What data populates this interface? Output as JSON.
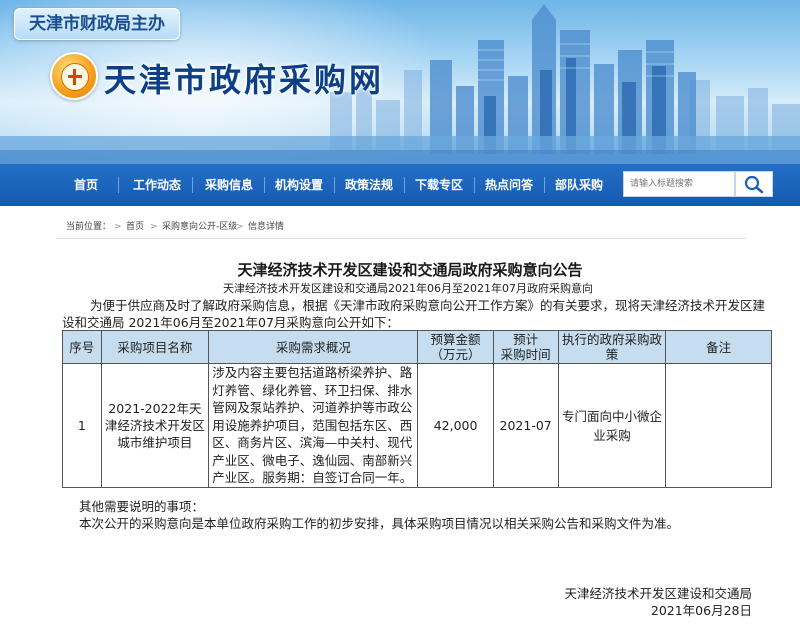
{
  "header": {
    "sponsor": "天津市财政局主办",
    "site_title": "天津市政府采购网",
    "logo_icon": "procurement-logo-icon"
  },
  "nav": {
    "items": [
      "首页",
      "工作动态",
      "采购信息",
      "机构设置",
      "政策法规",
      "下载专区",
      "热点问答",
      "部队采购"
    ],
    "search_placeholder": "请输入标题搜索",
    "search_icon": "search-icon"
  },
  "breadcrumb": {
    "label": "当前位置：",
    "items": [
      "首页",
      "采购意向公开-区级",
      "信息详情"
    ],
    "separator": ">"
  },
  "article": {
    "title": "天津经济技术开发区建设和交通局政府采购意向公告",
    "subtitle": "天津经济技术开发区建设和交通局2021年06月至2021年07月政府采购意向",
    "intro_line1": "为便于供应商及时了解政府采购信息，根据《天津市政府采购意向公开工作方案》的有关要求，现将天津经济技术开发区建",
    "intro_line2": "设和交通局 2021年06月至2021年07月采购意向公开如下：",
    "table": {
      "headers": {
        "no": "序号",
        "project": "采购项目名称",
        "requirement": "采购需求概况",
        "budget_l1": "预算金额",
        "budget_l2": "（万元）",
        "time_l1": "预计",
        "time_l2": "采购时间",
        "policy_l1": "执行的政府采购政",
        "policy_l2": "策",
        "remark": "备注"
      },
      "rows": [
        {
          "no": "1",
          "project": "2021-2022年天津经济技术开发区城市维护项目",
          "requirement": "涉及内容主要包括道路桥梁养护、路灯养管、绿化养管、环卫扫保、排水管网及泵站养护、河道养护等市政公用设施养护项目，范围包括东区、西区、商务片区、滨海—中关村、现代产业区、微电子、逸仙园、南部新兴产业区。服务期：自签订合同一年。",
          "budget": "42,000",
          "time": "2021-07",
          "policy": "专门面向中小微企业采购",
          "remark": ""
        }
      ]
    },
    "other_title": "其他需要说明的事项：",
    "other_text": "本次公开的采购意向是本单位政府采购工作的初步安排，具体采购项目情况以相关采购公告和采购文件为准。",
    "signature_org": "天津经济技术开发区建设和交通局",
    "signature_date": "2021年06月28日"
  },
  "colors": {
    "nav_bg": "#1a62b9",
    "title_blue": "#0d3f86",
    "table_header_bg": "#c6ddf0",
    "logo_orange": "#f7a21e"
  }
}
